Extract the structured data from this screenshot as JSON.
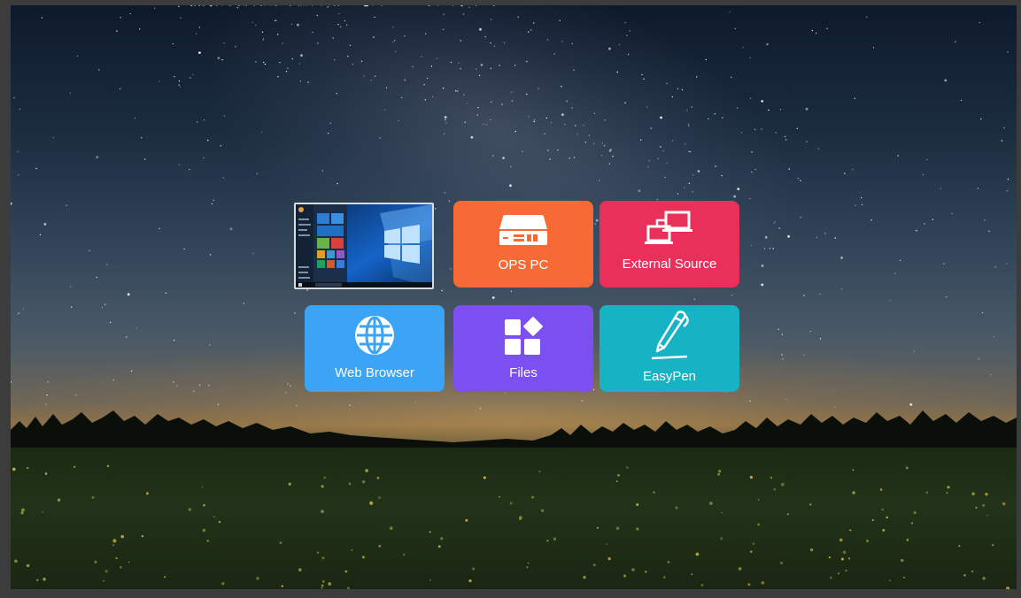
{
  "launcher": {
    "tiles": [
      {
        "id": "windows-preview",
        "label": "",
        "color": "#0b3b7a"
      },
      {
        "id": "ops-pc",
        "label": "OPS PC",
        "color": "#f86a35",
        "icon": "mini-pc-icon"
      },
      {
        "id": "external-source",
        "label": "External Source",
        "color": "#e9305a",
        "icon": "connected-monitors-icon"
      },
      {
        "id": "web-browser",
        "label": "Web Browser",
        "color": "#3ba4f4",
        "icon": "globe-icon"
      },
      {
        "id": "files",
        "label": "Files",
        "color": "#7b4ff0",
        "icon": "files-grid-icon"
      },
      {
        "id": "easypen",
        "label": "EasyPen",
        "color": "#16b3c4",
        "icon": "pen-icon"
      }
    ]
  },
  "wallpaper": {
    "sky_color": "#0d1a2b",
    "horizon_color": "#8b7148",
    "ground_color": "#1b2a12"
  }
}
